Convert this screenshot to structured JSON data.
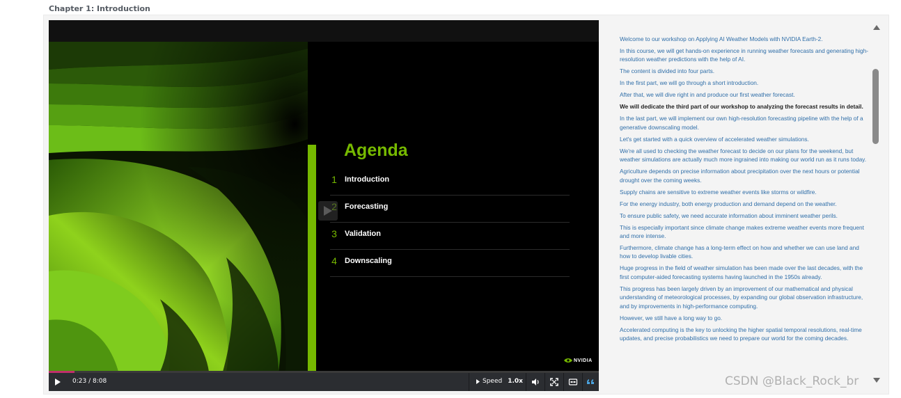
{
  "chapter": {
    "title": "Chapter 1: Introduction"
  },
  "slide": {
    "title": "Agenda",
    "items": [
      {
        "num": "1",
        "label": "Introduction"
      },
      {
        "num": "2",
        "label": "Forecasting"
      },
      {
        "num": "3",
        "label": "Validation"
      },
      {
        "num": "4",
        "label": "Downscaling"
      }
    ],
    "logo_text": "NVIDIA"
  },
  "player": {
    "time": "0:23 / 8:08",
    "progress": 0.047,
    "speed_label": "Speed",
    "speed_value": "1.0x",
    "accent": "#c0306a"
  },
  "transcript": {
    "active_index": 5,
    "lines": [
      "Welcome to our workshop on Applying AI Weather Models with NVIDIA Earth-2.",
      "In this course, we will get hands-on experience in running weather forecasts and generating high-resolution weather predictions with the help of AI.",
      "The content is divided into four parts.",
      "In the first part, we will go through a short introduction.",
      "After that, we will dive right in and produce our first weather forecast.",
      "We will dedicate the third part of our workshop to analyzing the forecast results in detail.",
      "In the last part, we will implement our own high-resolution forecasting pipeline with the help of a generative downscaling model.",
      "Let's get started with a quick overview of accelerated weather simulations.",
      "We're all used to checking the weather forecast to decide on our plans for the weekend, but weather simulations are actually much more ingrained into making our world run as it runs today.",
      "Agriculture depends on precise information about precipitation over the next hours or potential drought over the coming weeks.",
      "Supply chains are sensitive to extreme weather events like storms or wildfire.",
      "For the energy industry, both energy production and demand depend on the weather.",
      "To ensure public safety, we need accurate information about imminent weather perils.",
      "This is especially important since climate change makes extreme weather events more frequent and more intense.",
      "Furthermore, climate change has a long-term effect on how and whether we can use land and how to develop livable cities.",
      "Huge progress in the field of weather simulation has been made over the last decades, with the first computer-aided forecasting systems having launched in the 1950s already.",
      "This progress has been largely driven by an improvement of our mathematical and physical understanding of meteorological processes, by expanding our global observation infrastructure, and by improvements in high-performance computing.",
      "However, we still have a long way to go.",
      "Accelerated computing is the key to unlocking the higher spatial temporal resolutions, real-time updates, and precise probabilistics we need to prepare our world for the coming decades."
    ]
  },
  "watermark": {
    "text": "CSDN @Black_Rock_br"
  },
  "colors": {
    "nvidia_green": "#76b900",
    "link_blue": "#2f6ea8"
  }
}
